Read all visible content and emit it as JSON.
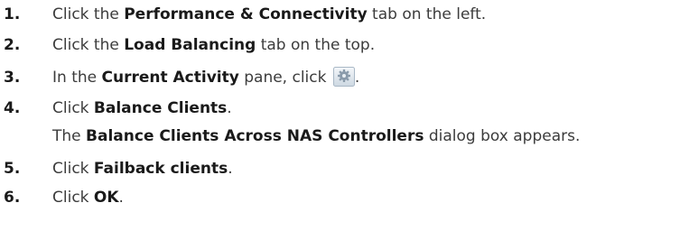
{
  "steps": [
    {
      "number": "1.",
      "pre": "Click the ",
      "bold": "Performance & Connectivity",
      "post": " tab on the left."
    },
    {
      "number": "2.",
      "pre": "Click the ",
      "bold": "Load Balancing",
      "post": " tab on the top."
    },
    {
      "number": "3.",
      "pre": "In the ",
      "bold": "Current Activity",
      "post": " pane, click ",
      "icon": "gear-icon",
      "post2": "."
    },
    {
      "number": "4.",
      "pre": "Click ",
      "bold": "Balance Clients",
      "post": "."
    },
    {
      "number": "",
      "pre": "The ",
      "bold": "Balance Clients Across NAS Controllers",
      "post": " dialog box appears."
    },
    {
      "number": "5.",
      "pre": "Click ",
      "bold": "Failback clients",
      "post": "."
    },
    {
      "number": "6.",
      "pre": "Click ",
      "bold": "OK",
      "post": "."
    }
  ]
}
